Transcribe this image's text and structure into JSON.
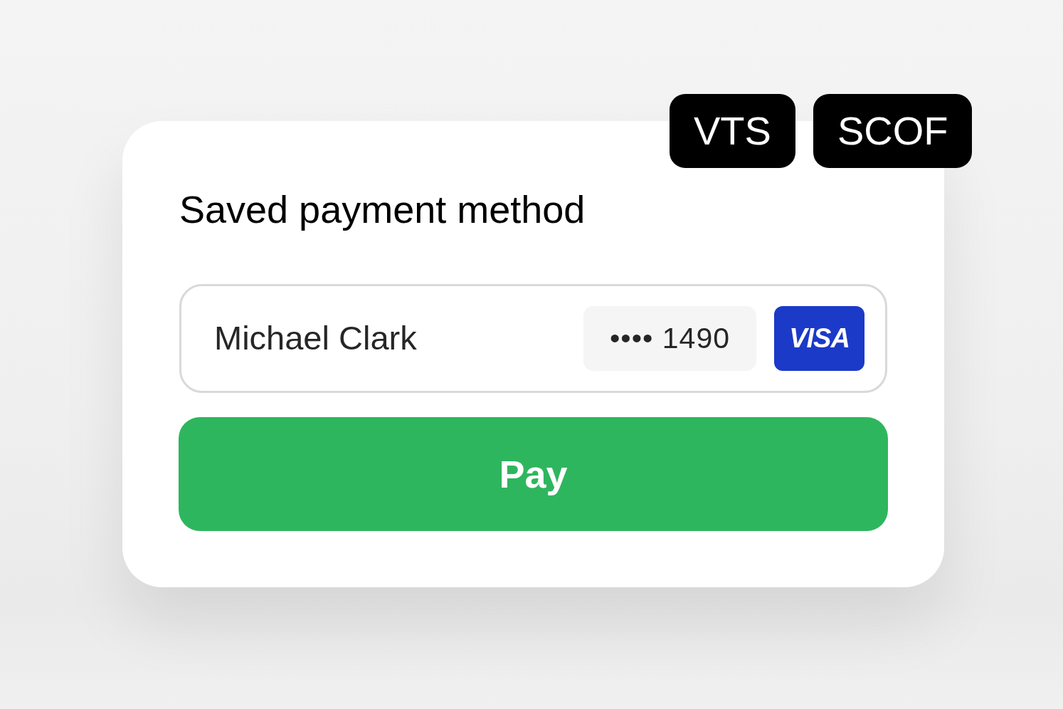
{
  "tags": [
    {
      "label": "VTS"
    },
    {
      "label": "SCOF"
    }
  ],
  "card": {
    "title": "Saved payment method",
    "saved_method": {
      "name": "Michael Clark",
      "masked_number": "•••• 1490",
      "brand": "VISA"
    },
    "pay_button": {
      "label": "Pay"
    }
  }
}
